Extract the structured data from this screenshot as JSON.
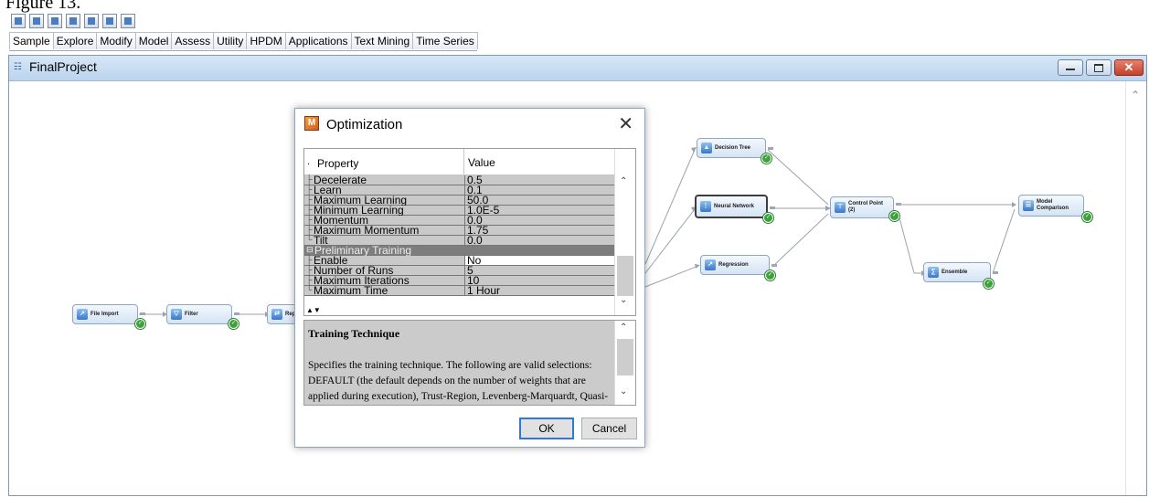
{
  "caption": "Figure 13.",
  "toolbar": {
    "icons": [
      "new-diagram-icon",
      "grid-icon",
      "chart-icon",
      "filter-icon",
      "table-icon",
      "layout-icon",
      "network-icon"
    ]
  },
  "menu_tabs": [
    "Sample",
    "Explore",
    "Modify",
    "Model",
    "Assess",
    "Utility",
    "HPDM",
    "Applications",
    "Text Mining",
    "Time Series"
  ],
  "window": {
    "title": "FinalProject"
  },
  "nodes": {
    "file_import": "File Import",
    "filter": "Filter",
    "replacement": "Repl",
    "decision_tree": "Decision Tree",
    "neural_network": "Neural Network",
    "regression": "Regression",
    "control_point": "Control Point\n(2)",
    "ensemble": "Ensemble",
    "model_comparison": "Model\nComparison"
  },
  "dialog": {
    "title": "Optimization",
    "columns": {
      "property": "Property",
      "value": "Value"
    },
    "rows": [
      {
        "key": "Decelerate",
        "value": "0.5"
      },
      {
        "key": "Learn",
        "value": "0.1"
      },
      {
        "key": "Maximum Learning",
        "value": "50.0"
      },
      {
        "key": "Minimum Learning",
        "value": "1.0E-5"
      },
      {
        "key": "Momentum",
        "value": "0.0"
      },
      {
        "key": "Maximum Momentum",
        "value": "1.75"
      },
      {
        "key": "Tilt",
        "value": "0.0"
      },
      {
        "key": "Preliminary Training",
        "value": "",
        "group": true
      },
      {
        "key": "Enable",
        "value": "No",
        "selected": true
      },
      {
        "key": "Number of Runs",
        "value": "5"
      },
      {
        "key": "Maximum Iterations",
        "value": "10"
      },
      {
        "key": "Maximum Time",
        "value": "1 Hour"
      }
    ],
    "description": {
      "title": "Training Technique",
      "body": "Specifies the training technique. The following are valid selections: DEFAULT (the default depends on the number of weights that are applied during execution), Trust-Region, Levenberg-Marquardt, Quasi-Newton, Conjugate Gradient, DBLDOG, BackProp, RPROP (uses"
    },
    "ok_label": "OK",
    "cancel_label": "Cancel"
  }
}
